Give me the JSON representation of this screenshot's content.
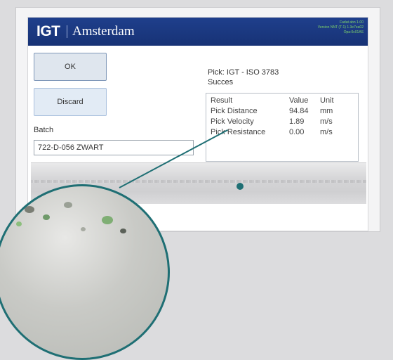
{
  "header": {
    "brand": "IGT",
    "app_name": "Amsterdam",
    "info_lines": [
      "Fadat abn 1-00",
      "Version NNT (T-1) 1.3e7ea02",
      "Opa:0c01AS"
    ]
  },
  "actions": {
    "ok_label": "OK",
    "discard_label": "Discard"
  },
  "batch": {
    "label": "Batch",
    "value": "722-D-056 ZWART"
  },
  "pick": {
    "title": "Pick: IGT - ISO 3783",
    "status": "Succes"
  },
  "results": {
    "headers": [
      "Result",
      "Value",
      "Unit"
    ],
    "rows": [
      [
        "Pick Distance",
        "94.84",
        "mm"
      ],
      [
        "Pick Velocity",
        "1.89",
        "m/s"
      ],
      [
        "Pick Resistance",
        "0.00",
        "m/s"
      ]
    ]
  },
  "colors": {
    "title_bar": "#1f3f8c",
    "accent": "#1f6f74",
    "status_text": "#7fd36a"
  }
}
